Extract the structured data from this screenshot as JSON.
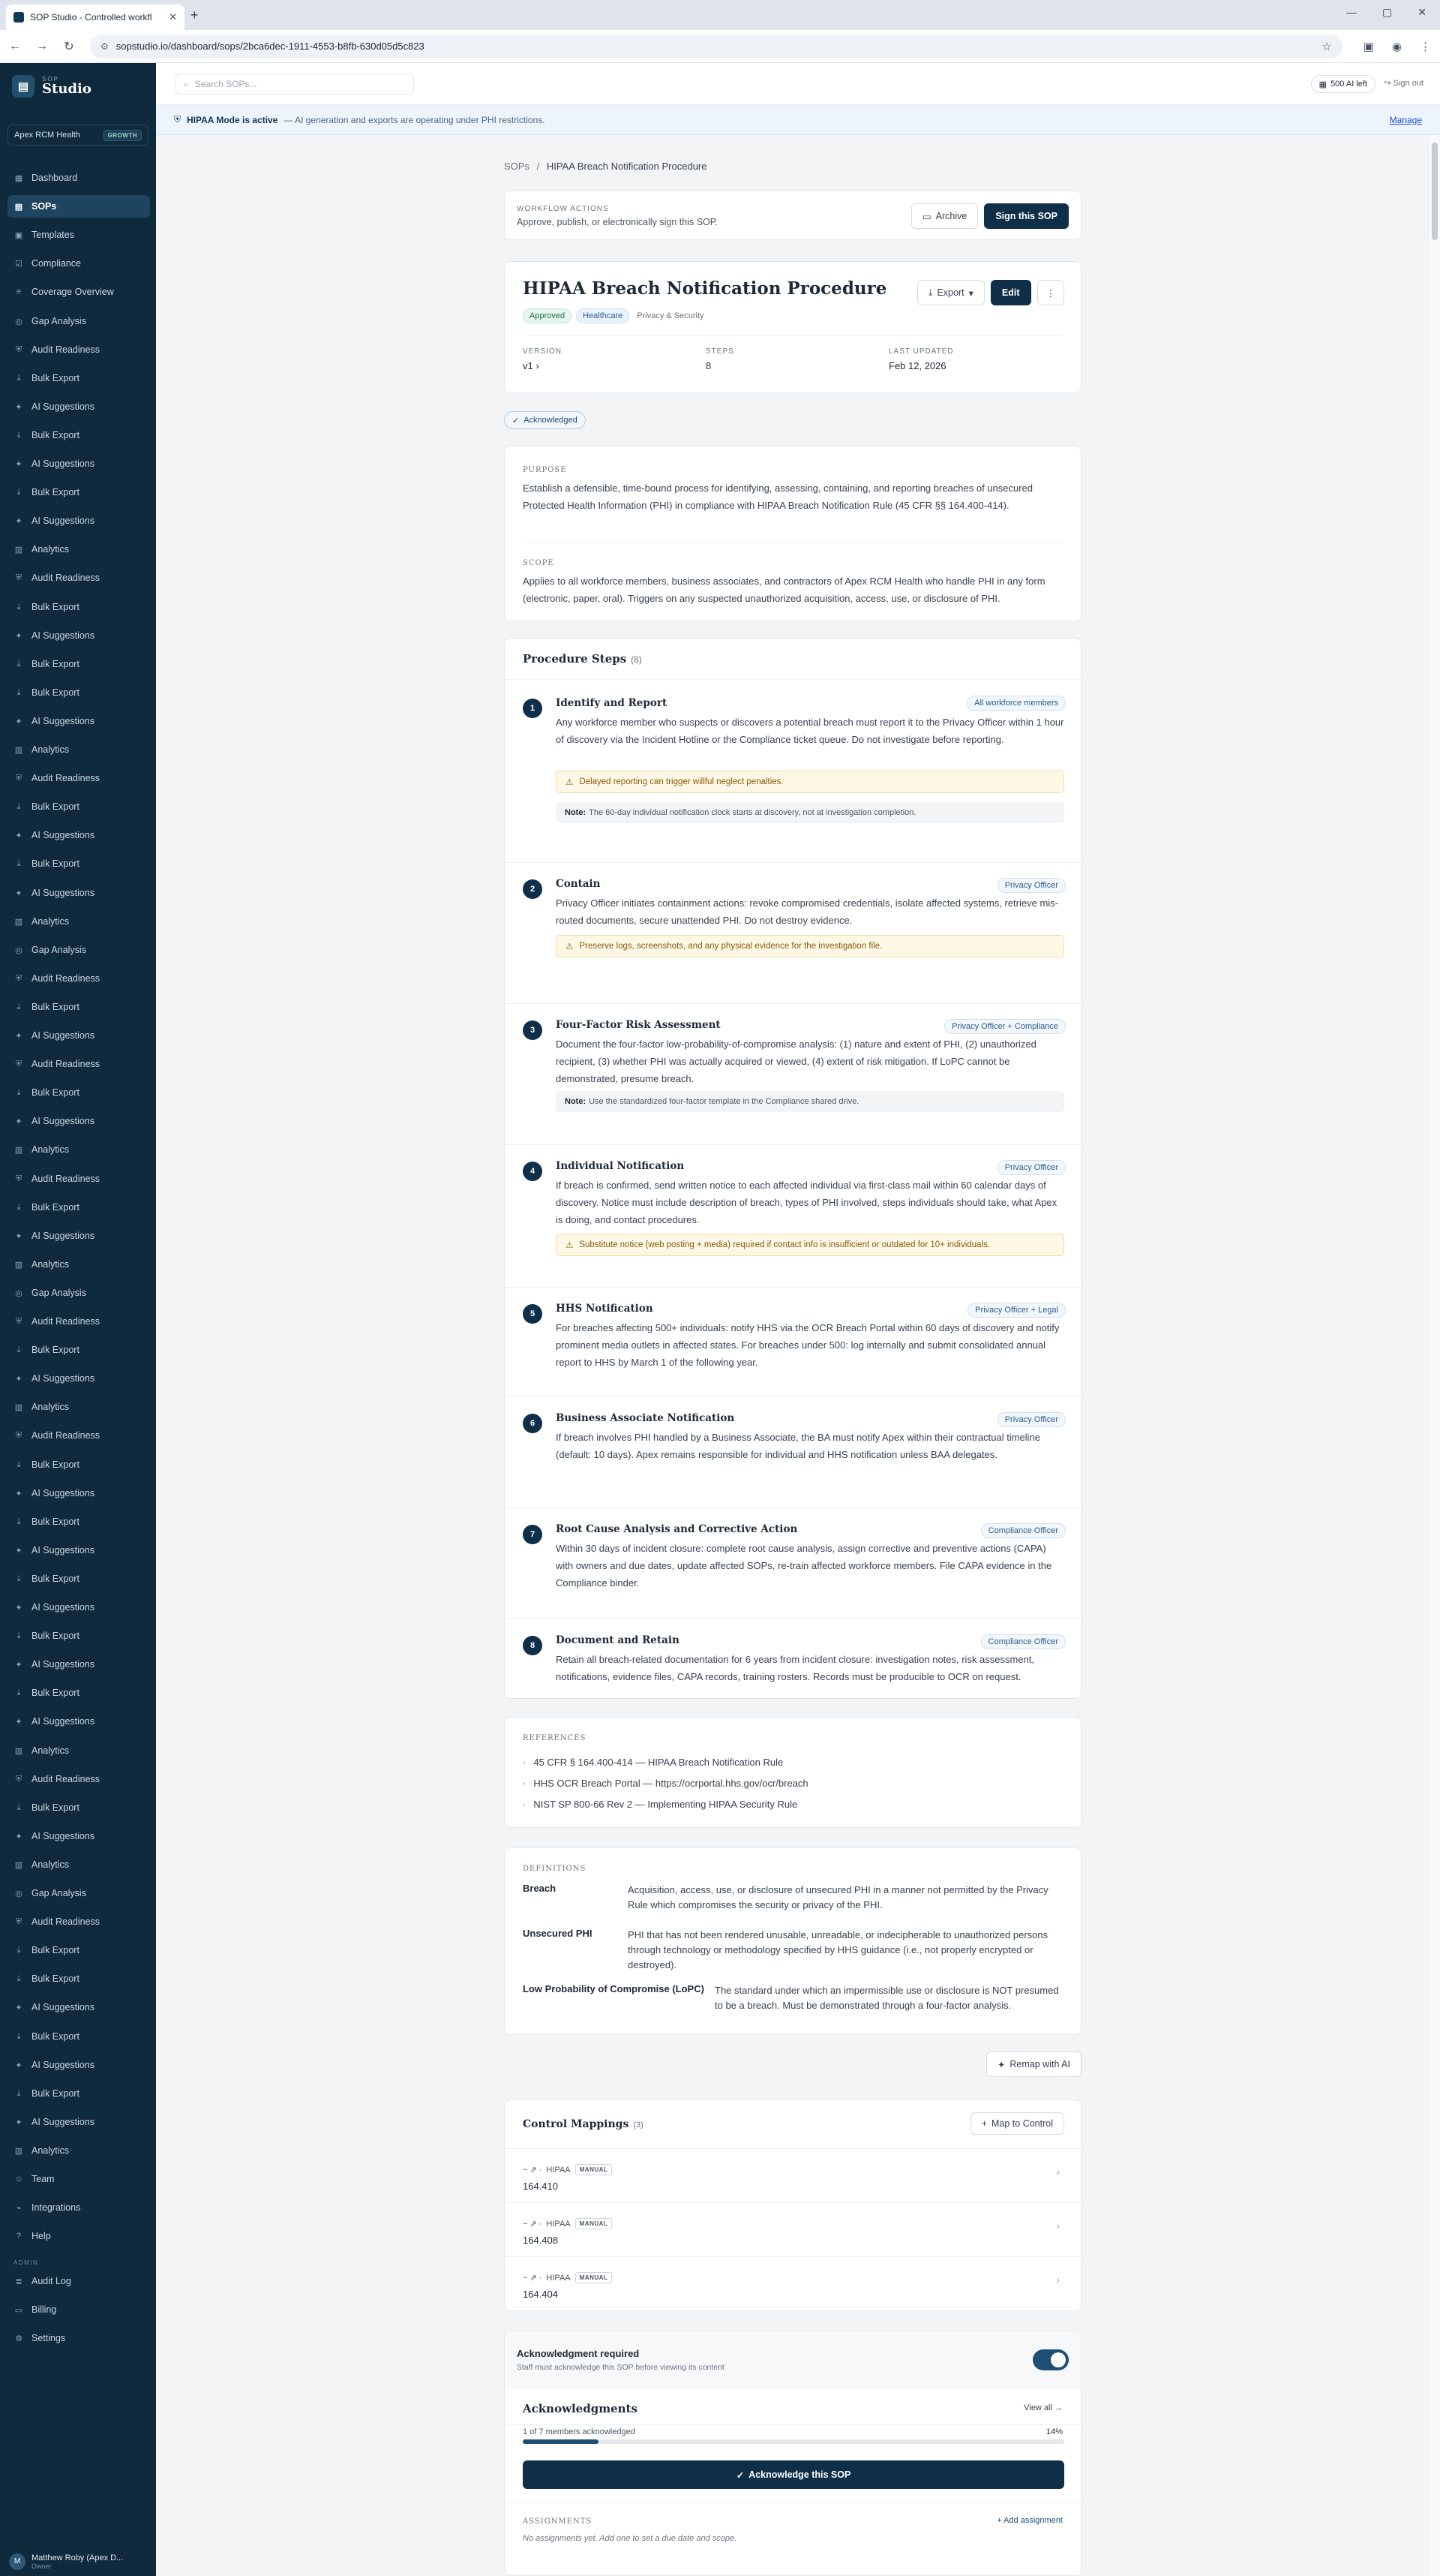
{
  "browser": {
    "tab_title": "SOP Studio - Controlled workfl",
    "url": "sopstudio.io/dashboard/sops/2bca6dec-1911-4553-b8fb-630d05d5c823"
  },
  "sidebar": {
    "brand_sub": "SOP",
    "brand_name": "Studio",
    "org_name": "Apex RCM Health",
    "org_plan": "GROWTH",
    "items": [
      {
        "label": "Dashboard",
        "icon": "grid-icon",
        "active": false
      },
      {
        "label": "SOPs",
        "icon": "document-icon",
        "active": true
      },
      {
        "label": "Templates",
        "icon": "template-icon",
        "active": false
      },
      {
        "label": "Compliance",
        "icon": "check-square-icon",
        "active": false
      },
      {
        "label": "Coverage Overview",
        "icon": "layers-icon",
        "active": false
      },
      {
        "label": "Gap Analysis",
        "icon": "target-icon",
        "active": false
      },
      {
        "label": "Audit Readiness",
        "icon": "shield-icon",
        "active": false
      },
      {
        "label": "Bulk Export",
        "icon": "export-icon",
        "active": false
      },
      {
        "label": "AI Suggestions",
        "icon": "sparkle-icon",
        "active": false
      },
      {
        "label": "Bulk Export",
        "icon": "export-icon",
        "active": false
      },
      {
        "label": "AI Suggestions",
        "icon": "sparkle-icon",
        "active": false
      },
      {
        "label": "Bulk Export",
        "icon": "export-icon",
        "active": false
      },
      {
        "label": "AI Suggestions",
        "icon": "sparkle-icon",
        "active": false
      },
      {
        "label": "Analytics",
        "icon": "chart-icon",
        "active": false
      },
      {
        "label": "Audit Readiness",
        "icon": "shield-icon",
        "active": false
      },
      {
        "label": "Bulk Export",
        "icon": "export-icon",
        "active": false
      },
      {
        "label": "AI Suggestions",
        "icon": "sparkle-icon",
        "active": false
      },
      {
        "label": "Bulk Export",
        "icon": "export-icon",
        "active": false
      },
      {
        "label": "Bulk Export",
        "icon": "export-icon",
        "active": false
      },
      {
        "label": "AI Suggestions",
        "icon": "sparkle-icon",
        "active": false
      },
      {
        "label": "Analytics",
        "icon": "chart-icon",
        "active": false
      },
      {
        "label": "Audit Readiness",
        "icon": "shield-icon",
        "active": false
      },
      {
        "label": "Bulk Export",
        "icon": "export-icon",
        "active": false
      },
      {
        "label": "AI Suggestions",
        "icon": "sparkle-icon",
        "active": false
      },
      {
        "label": "Bulk Export",
        "icon": "export-icon",
        "active": false
      },
      {
        "label": "AI Suggestions",
        "icon": "sparkle-icon",
        "active": false
      },
      {
        "label": "Analytics",
        "icon": "chart-icon",
        "active": false
      },
      {
        "label": "Gap Analysis",
        "icon": "target-icon",
        "active": false
      },
      {
        "label": "Audit Readiness",
        "icon": "shield-icon",
        "active": false
      },
      {
        "label": "Bulk Export",
        "icon": "export-icon",
        "active": false
      },
      {
        "label": "AI Suggestions",
        "icon": "sparkle-icon",
        "active": false
      },
      {
        "label": "Audit Readiness",
        "icon": "shield-icon",
        "active": false
      },
      {
        "label": "Bulk Export",
        "icon": "export-icon",
        "active": false
      },
      {
        "label": "AI Suggestions",
        "icon": "sparkle-icon",
        "active": false
      },
      {
        "label": "Analytics",
        "icon": "chart-icon",
        "active": false
      },
      {
        "label": "Audit Readiness",
        "icon": "shield-icon",
        "active": false
      },
      {
        "label": "Bulk Export",
        "icon": "export-icon",
        "active": false
      },
      {
        "label": "AI Suggestions",
        "icon": "sparkle-icon",
        "active": false
      },
      {
        "label": "Analytics",
        "icon": "chart-icon",
        "active": false
      },
      {
        "label": "Gap Analysis",
        "icon": "target-icon",
        "active": false
      },
      {
        "label": "Audit Readiness",
        "icon": "shield-icon",
        "active": false
      },
      {
        "label": "Bulk Export",
        "icon": "export-icon",
        "active": false
      },
      {
        "label": "AI Suggestions",
        "icon": "sparkle-icon",
        "active": false
      },
      {
        "label": "Analytics",
        "icon": "chart-icon",
        "active": false
      },
      {
        "label": "Audit Readiness",
        "icon": "shield-icon",
        "active": false
      },
      {
        "label": "Bulk Export",
        "icon": "export-icon",
        "active": false
      },
      {
        "label": "AI Suggestions",
        "icon": "sparkle-icon",
        "active": false
      },
      {
        "label": "Bulk Export",
        "icon": "export-icon",
        "active": false
      },
      {
        "label": "AI Suggestions",
        "icon": "sparkle-icon",
        "active": false
      },
      {
        "label": "Bulk Export",
        "icon": "export-icon",
        "active": false
      },
      {
        "label": "AI Suggestions",
        "icon": "sparkle-icon",
        "active": false
      },
      {
        "label": "Bulk Export",
        "icon": "export-icon",
        "active": false
      },
      {
        "label": "AI Suggestions",
        "icon": "sparkle-icon",
        "active": false
      },
      {
        "label": "Bulk Export",
        "icon": "export-icon",
        "active": false
      },
      {
        "label": "AI Suggestions",
        "icon": "sparkle-icon",
        "active": false
      },
      {
        "label": "Analytics",
        "icon": "chart-icon",
        "active": false
      },
      {
        "label": "Audit Readiness",
        "icon": "shield-icon",
        "active": false
      },
      {
        "label": "Bulk Export",
        "icon": "export-icon",
        "active": false
      },
      {
        "label": "AI Suggestions",
        "icon": "sparkle-icon",
        "active": false
      },
      {
        "label": "Analytics",
        "icon": "chart-icon",
        "active": false
      },
      {
        "label": "Gap Analysis",
        "icon": "target-icon",
        "active": false
      },
      {
        "label": "Audit Readiness",
        "icon": "shield-icon",
        "active": false
      },
      {
        "label": "Bulk Export",
        "icon": "export-icon",
        "active": false
      },
      {
        "label": "Bulk Export",
        "icon": "export-icon",
        "active": false
      },
      {
        "label": "AI Suggestions",
        "icon": "sparkle-icon",
        "active": false
      },
      {
        "label": "Bulk Export",
        "icon": "export-icon",
        "active": false
      },
      {
        "label": "AI Suggestions",
        "icon": "sparkle-icon",
        "active": false
      },
      {
        "label": "Bulk Export",
        "icon": "export-icon",
        "active": false
      },
      {
        "label": "AI Suggestions",
        "icon": "sparkle-icon",
        "active": false
      },
      {
        "label": "Analytics",
        "icon": "chart-icon",
        "active": false
      },
      {
        "label": "Team",
        "icon": "users-icon",
        "active": false
      },
      {
        "label": "Integrations",
        "icon": "plug-icon",
        "active": false
      },
      {
        "label": "Help",
        "icon": "help-icon",
        "active": false
      }
    ],
    "admin_section": "ADMIN",
    "admin_items": [
      {
        "label": "Audit Log",
        "icon": "log-icon"
      },
      {
        "label": "Billing",
        "icon": "card-icon"
      },
      {
        "label": "Settings",
        "icon": "gear-icon"
      }
    ],
    "user_initial": "M",
    "user_name": "Matthew Roby (Apex D...",
    "user_role": "Owner"
  },
  "header": {
    "search_placeholder": "Search SOPs...",
    "credits": "500 AI left",
    "signout": "Sign out"
  },
  "hipaa_banner": {
    "title": "HIPAA Mode is active",
    "text": "— AI generation and exports are operating under PHI restrictions.",
    "manage": "Manage"
  },
  "breadcrumb": {
    "root": "SOPs",
    "sep": "/",
    "current": "HIPAA Breach Notification Procedure"
  },
  "workflow": {
    "label": "WORKFLOW ACTIONS",
    "text": "Approve, publish, or electronically sign this SOP.",
    "archive": "Archive",
    "sign": "Sign this SOP"
  },
  "sop": {
    "title": "HIPAA Breach Notification Procedure",
    "status": "Approved",
    "industry": "Healthcare",
    "category": "Privacy & Security",
    "export": "Export",
    "edit": "Edit",
    "version_label": "VERSION",
    "version": "v1",
    "steps_label": "STEPS",
    "steps": "8",
    "updated_label": "LAST UPDATED",
    "updated": "Feb 12, 2026",
    "ack_badge": "Acknowledged"
  },
  "purpose": {
    "label": "PURPOSE",
    "text": "Establish a defensible, time-bound process for identifying, assessing, containing, and reporting breaches of unsecured Protected Health Information (PHI) in compliance with HIPAA Breach Notification Rule (45 CFR §§ 164.400-414)."
  },
  "scope": {
    "label": "SCOPE",
    "text": "Applies to all workforce members, business associates, and contractors of Apex RCM Health who handle PHI in any form (electronic, paper, oral). Triggers on any suspected unauthorized acquisition, access, use, or disclosure of PHI."
  },
  "procedure": {
    "title": "Procedure Steps",
    "count": "(8)",
    "steps": [
      {
        "num": "1",
        "title": "Identify and Report",
        "role": "All workforce members",
        "desc": "Any workforce member who suspects or discovers a potential breach must report it to the Privacy Officer within 1 hour of discovery via the Incident Hotline or the Compliance ticket queue. Do not investigate before reporting.",
        "warning": "Delayed reporting can trigger willful neglect penalties.",
        "note_label": "Note:",
        "note": "The 60-day individual notification clock starts at discovery, not at investigation completion."
      },
      {
        "num": "2",
        "title": "Contain",
        "role": "Privacy Officer",
        "desc": "Privacy Officer initiates containment actions: revoke compromised credentials, isolate affected systems, retrieve mis-routed documents, secure unattended PHI. Do not destroy evidence.",
        "warning": "Preserve logs, screenshots, and any physical evidence for the investigation file.",
        "note_label": "",
        "note": ""
      },
      {
        "num": "3",
        "title": "Four-Factor Risk Assessment",
        "role": "Privacy Officer + Compliance",
        "desc": "Document the four-factor low-probability-of-compromise analysis: (1) nature and extent of PHI, (2) unauthorized recipient, (3) whether PHI was actually acquired or viewed, (4) extent of risk mitigation. If LoPC cannot be demonstrated, presume breach.",
        "warning": "",
        "note_label": "Note:",
        "note": "Use the standardized four-factor template in the Compliance shared drive."
      },
      {
        "num": "4",
        "title": "Individual Notification",
        "role": "Privacy Officer",
        "desc": "If breach is confirmed, send written notice to each affected individual via first-class mail within 60 calendar days of discovery. Notice must include description of breach, types of PHI involved, steps individuals should take, what Apex is doing, and contact procedures.",
        "warning": "Substitute notice (web posting + media) required if contact info is insufficient or outdated for 10+ individuals.",
        "note_label": "",
        "note": ""
      },
      {
        "num": "5",
        "title": "HHS Notification",
        "role": "Privacy Officer + Legal",
        "desc": "For breaches affecting 500+ individuals: notify HHS via the OCR Breach Portal within 60 days of discovery and notify prominent media outlets in affected states. For breaches under 500: log internally and submit consolidated annual report to HHS by March 1 of the following year.",
        "warning": "",
        "note_label": "",
        "note": ""
      },
      {
        "num": "6",
        "title": "Business Associate Notification",
        "role": "Privacy Officer",
        "desc": "If breach involves PHI handled by a Business Associate, the BA must notify Apex within their contractual timeline (default: 10 days). Apex remains responsible for individual and HHS notification unless BAA delegates.",
        "warning": "",
        "note_label": "",
        "note": ""
      },
      {
        "num": "7",
        "title": "Root Cause Analysis and Corrective Action",
        "role": "Compliance Officer",
        "desc": "Within 30 days of incident closure: complete root cause analysis, assign corrective and preventive actions (CAPA) with owners and due dates, update affected SOPs, re-train affected workforce members. File CAPA evidence in the Compliance binder.",
        "warning": "",
        "note_label": "",
        "note": ""
      },
      {
        "num": "8",
        "title": "Document and Retain",
        "role": "Compliance Officer",
        "desc": "Retain all breach-related documentation for 6 years from incident closure: investigation notes, risk assessment, notifications, evidence files, CAPA records, training rosters. Records must be producible to OCR on request.",
        "warning": "",
        "note_label": "",
        "note": ""
      }
    ]
  },
  "references": {
    "label": "REFERENCES",
    "items": [
      "45 CFR § 164.400-414 — HIPAA Breach Notification Rule",
      "HHS OCR Breach Portal — https://ocrportal.hhs.gov/ocr/breach",
      "NIST SP 800-66 Rev 2 — Implementing HIPAA Security Rule"
    ]
  },
  "definitions": {
    "label": "DEFINITIONS",
    "items": [
      {
        "term": "Breach",
        "def": "Acquisition, access, use, or disclosure of unsecured PHI in a manner not permitted by the Privacy Rule which compromises the security or privacy of the PHI."
      },
      {
        "term": "Unsecured PHI",
        "def": "PHI that has not been rendered unusable, unreadable, or indecipherable to unauthorized persons through technology or methodology specified by HHS guidance (i.e., not properly encrypted or destroyed)."
      },
      {
        "term": "Low Probability of Compromise (LoPC)",
        "def": "The standard under which an impermissible use or disclosure is NOT presumed to be a breach. Must be demonstrated through a four-factor analysis."
      }
    ]
  },
  "remap": "Remap with AI",
  "controls": {
    "title": "Control Mappings",
    "count": "(3)",
    "add": "Map to Control",
    "rows": [
      {
        "framework": "HIPAA",
        "tag": "MANUAL",
        "code": "164.410"
      },
      {
        "framework": "HIPAA",
        "tag": "MANUAL",
        "code": "164.408"
      },
      {
        "framework": "HIPAA",
        "tag": "MANUAL",
        "code": "164.404"
      }
    ]
  },
  "ack_required": {
    "title": "Acknowledgment required",
    "subtitle": "Staff must acknowledge this SOP before viewing its content",
    "enabled": true
  },
  "acknowledgments": {
    "title": "Acknowledgments",
    "view_all": "View all →",
    "summary": "1 of 7 members acknowledged",
    "percent_text": "14%",
    "progress": 0.14,
    "button": "Acknowledge this SOP",
    "assignments_label": "ASSIGNMENTS",
    "add_assignment": "+ Add assignment",
    "empty": "No assignments yet. Add one to set a due date and scope."
  },
  "colors": {
    "sidebar": "#0f2a3d",
    "accent": "#0f2f48",
    "warning_bg": "#fdf8e6",
    "success": "#1f6f45"
  }
}
